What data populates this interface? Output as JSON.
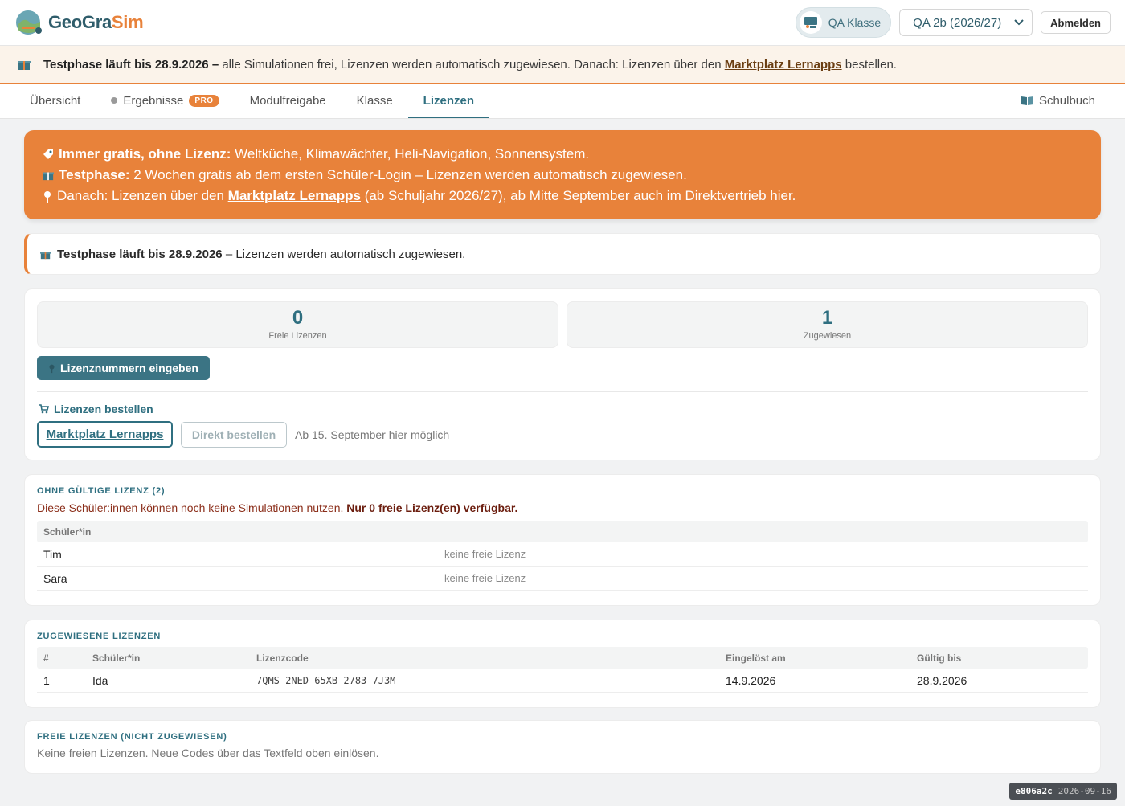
{
  "app": {
    "name_part1": "GeoGra",
    "name_part2": "Sim"
  },
  "header": {
    "class_chip": "QA Klasse",
    "class_select": "QA 2b (2026/27)",
    "logout": "Abmelden"
  },
  "trial_banner": {
    "bold": "Testphase läuft bis 28.9.2026 –",
    "text": " alle Simulationen frei, Lizenzen werden automatisch zugewiesen. Danach: Lizenzen über den ",
    "link": "Marktplatz Lernapps",
    "tail": " bestellen."
  },
  "tabs": [
    {
      "label": "Übersicht"
    },
    {
      "label": "Ergebnisse",
      "badge": "PRO"
    },
    {
      "label": "Modulfreigabe"
    },
    {
      "label": "Klasse"
    },
    {
      "label": "Lizenzen"
    },
    {
      "label": "Schulbuch"
    }
  ],
  "info_box": {
    "line1_bold": "Immer gratis, ohne Lizenz:",
    "line1_text": " Weltküche, Klimawächter, Heli-Navigation, Sonnensystem.",
    "line2_bold": "Testphase:",
    "line2_text": " 2 Wochen gratis ab dem ersten Schüler-Login – Lizenzen werden automatisch zugewiesen.",
    "line3_text": "Danach: Lizenzen über den ",
    "line3_link": "Marktplatz Lernapps",
    "line3_tail": " (ab Schuljahr 2026/27), ab Mitte September auch im Direktvertrieb hier."
  },
  "notice": {
    "bold": "Testphase läuft bis 28.9.2026",
    "text": " – Lizenzen werden automatisch zugewiesen."
  },
  "stats": {
    "free_value": "0",
    "free_label": "Freie Lizenzen",
    "assigned_value": "1",
    "assigned_label": "Zugewiesen",
    "enter_button": "Lizenznummern eingeben"
  },
  "order": {
    "heading": "Lizenzen bestellen",
    "marketplace_button": "Marktplatz Lernapps",
    "direct_button": "Direkt bestellen",
    "hint": "Ab 15. September hier möglich"
  },
  "no_license": {
    "title": "OHNE GÜLTIGE LIZENZ (2)",
    "warning_text": "Diese Schüler:innen können noch keine Simulationen nutzen. ",
    "warning_bold": "Nur 0 freie Lizenz(en) verfügbar.",
    "column": "Schüler*in",
    "rows": [
      {
        "name": "Tim",
        "status": "keine freie Lizenz"
      },
      {
        "name": "Sara",
        "status": "keine freie Lizenz"
      }
    ]
  },
  "assigned": {
    "title": "ZUGEWIESENE LIZENZEN",
    "columns": [
      "#",
      "Schüler*in",
      "Lizenzcode",
      "Eingelöst am",
      "Gültig bis"
    ],
    "rows": [
      {
        "num": "1",
        "name": "Ida",
        "code": "7QMS-2NED-65XB-2783-7J3M",
        "redeemed": "14.9.2026",
        "valid": "28.9.2026"
      }
    ]
  },
  "free": {
    "title": "FREIE LIZENZEN (NICHT ZUGEWIESEN)",
    "text": "Keine freien Lizenzen. Neue Codes über das Textfeld oben einlösen."
  },
  "version": {
    "hash": "e806a2c",
    "date": "2026-09-16"
  },
  "colors": {
    "accent_orange": "#e8823a",
    "primary_teal": "#2f6f80"
  }
}
